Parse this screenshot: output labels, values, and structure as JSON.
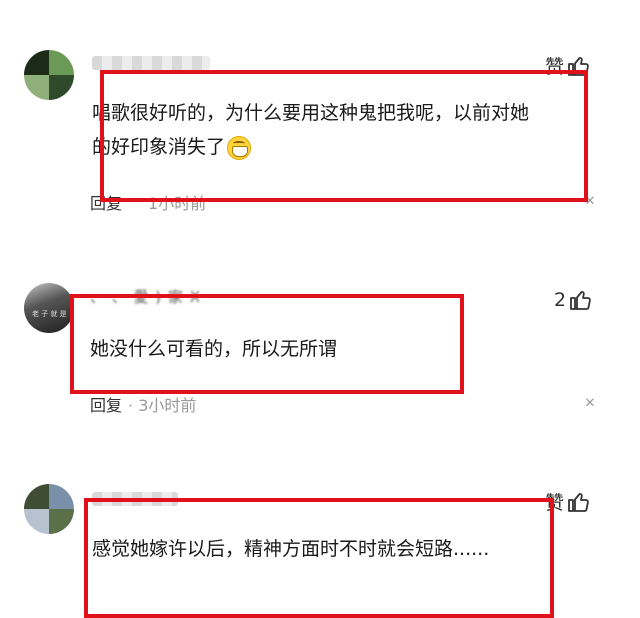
{
  "comments": [
    {
      "id": "c1",
      "username": "",
      "text_lines": [
        "唱歌很好听的，为什么要用这种鬼把我呢，以前对她",
        "的好印象消失了"
      ],
      "emoji": "grinning-face-emoji",
      "reply_label": "回复",
      "time": "1小时前",
      "like_label": "赞",
      "like_count": ""
    },
    {
      "id": "c2",
      "username": "、 、 愛 ) 家 X",
      "avatar_text": "老 子 就 是",
      "text_lines": [
        "她没什么可看的，所以无所谓"
      ],
      "reply_label": "回复",
      "time": "· 3小时前",
      "like_label": "",
      "like_count": "2"
    },
    {
      "id": "c3",
      "username": "",
      "text_lines": [
        "感觉她嫁许以后，精神方面时不时就会短路......"
      ],
      "like_label": "赞",
      "like_count": ""
    }
  ],
  "icons": {
    "like": "thumbs-up-icon",
    "close": "close-icon"
  },
  "colors": {
    "highlight_box": "#e0111b",
    "meta_text": "#999999"
  }
}
